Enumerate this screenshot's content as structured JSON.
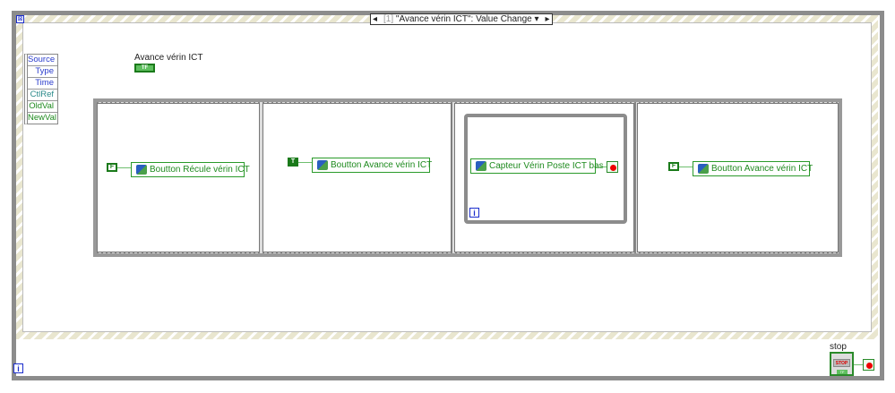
{
  "event_structure": {
    "selector": {
      "index": "[1]",
      "label": "\"Avance vérin ICT\": Value Change"
    }
  },
  "event_data_node": [
    "Source",
    "Type",
    "Time",
    "CtlRef",
    "OldVal",
    "NewVal"
  ],
  "control": {
    "label": "Avance vérin ICT",
    "terminal": "TF"
  },
  "frames": [
    {
      "constant": "F",
      "property": "Boutton Récule vérin ICT"
    },
    {
      "constant": "T",
      "property": "Boutton Avance vérin ICT"
    },
    {
      "property": "Capteur Vérin Poste ICT bas",
      "loop_iter": "i"
    },
    {
      "constant": "F",
      "property": "Boutton Avance vérin ICT"
    }
  ],
  "outer_loop": {
    "iter": "i",
    "stop_label": "stop",
    "stop_button": "STOP",
    "stop_terminal": "TF"
  },
  "colors": {
    "wire_bool": "#1e8a1e",
    "loop": "#8c8c8c",
    "iter": "#1a2ccc"
  }
}
